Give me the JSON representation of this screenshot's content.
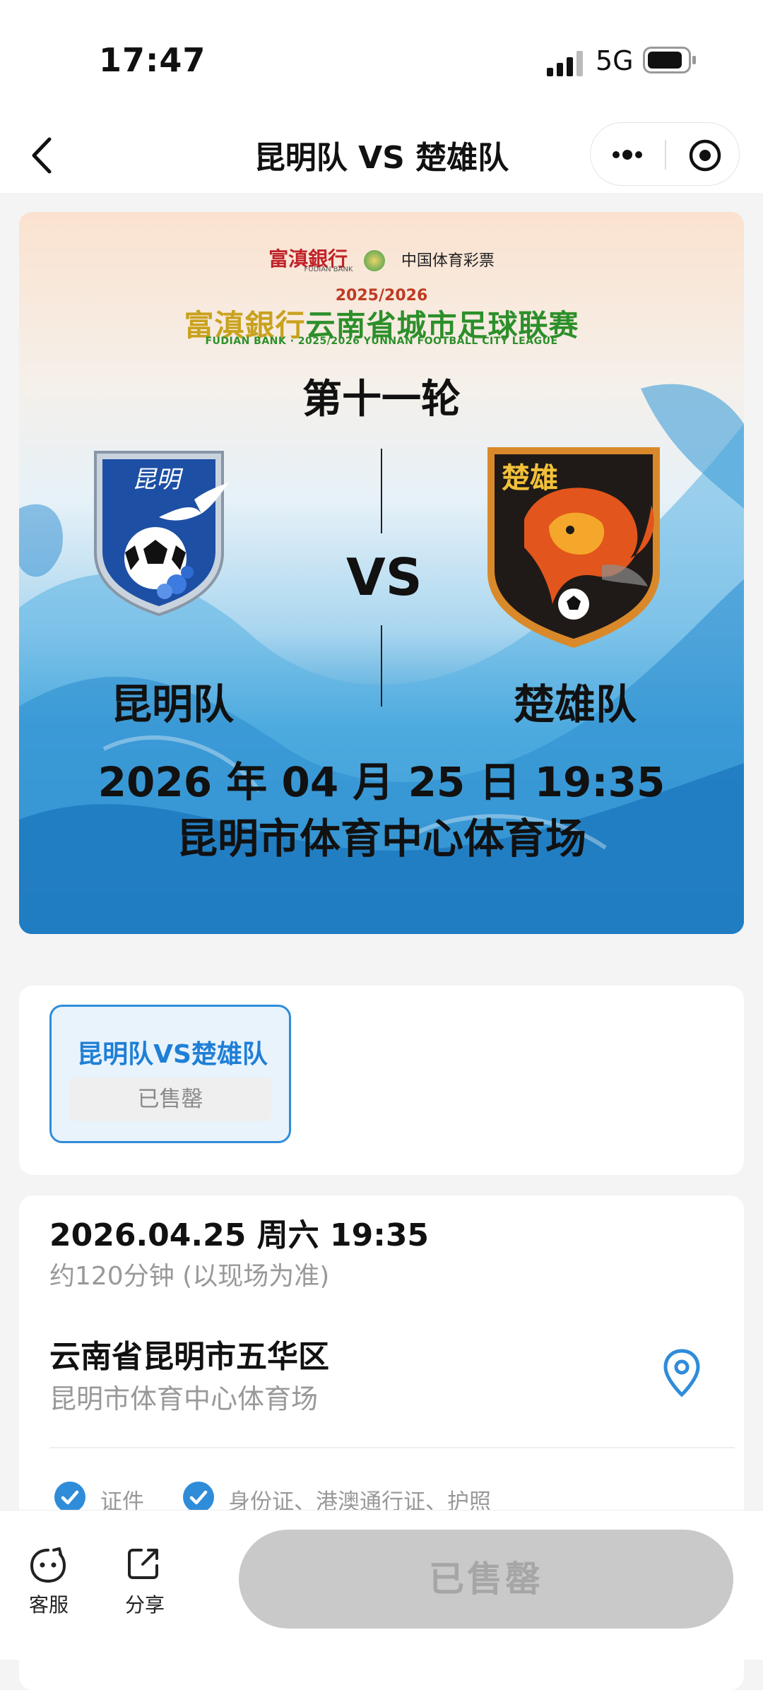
{
  "status_bar": {
    "time": "17:47",
    "network": "5G",
    "signal_icon": "signal-bars-icon",
    "battery_icon": "battery-icon"
  },
  "nav": {
    "title": "昆明队 VS 楚雄队",
    "back_icon": "chevron-left-icon",
    "more_icon": "more-dots-icon",
    "close_icon": "target-circle-icon"
  },
  "banner": {
    "sponsor_bank": "富滇銀行",
    "sponsor_bank_en": "FUDIAN BANK",
    "sponsor_lottery": "中国体育彩票",
    "league_year": "2025/2026",
    "league_name_bank": "富滇銀行",
    "league_name_main": "云南省城市足球联赛",
    "league_name_en": "FUDIAN BANK · 2025/2026 YUNNAN FOOTBALL CITY LEAGUE",
    "round": "第十一轮",
    "vs": "VS",
    "home_team": "昆明队",
    "away_team": "楚雄队",
    "home_badge_text": "昆明",
    "away_badge_text": "楚雄",
    "datetime": "2026 年 04 月 25 日 19:35",
    "venue": "昆明市体育中心体育场",
    "colors": {
      "wave_blue": "#1d7fc6",
      "wave_light": "#a9d6ef"
    }
  },
  "session": {
    "title": "昆明队VS楚雄队",
    "status": "已售罄",
    "accent": "#2f8cd9"
  },
  "info": {
    "datetime": "2026.04.25 周六 19:35",
    "duration": "约120分钟 (以现场为准)",
    "region": "云南省昆明市五华区",
    "venue": "昆明市体育中心体育场",
    "location_icon": "location-pin-icon",
    "cert_label": "证件",
    "cert_types": "身份证、港澳通行证、护照"
  },
  "bottom_bar": {
    "service_label": "客服",
    "service_icon": "chat-face-icon",
    "share_label": "分享",
    "share_icon": "share-icon",
    "buy_label": "已售罄"
  }
}
